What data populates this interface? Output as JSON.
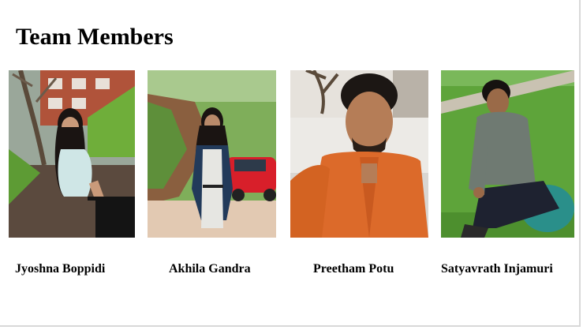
{
  "page": {
    "title": "Team Members"
  },
  "members": [
    {
      "name": "Jyoshna Boppidi"
    },
    {
      "name": "Akhila Gandra"
    },
    {
      "name": "Preetham Potu"
    },
    {
      "name": "Satyavrath Injamuri"
    }
  ],
  "colors": {
    "background": "#ffffff",
    "text": "#000000"
  }
}
